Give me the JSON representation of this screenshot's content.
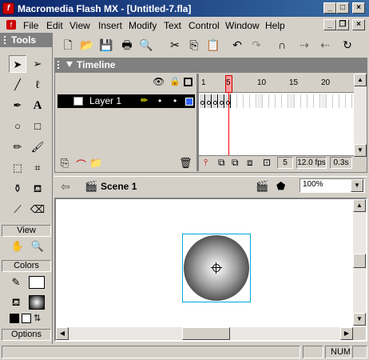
{
  "window": {
    "title": "Macromedia Flash MX - [Untitled-7.fla]",
    "app_icon": "flash-icon",
    "controls": [
      "minimize",
      "maximize",
      "close"
    ]
  },
  "menubar": {
    "items": [
      "File",
      "Edit",
      "View",
      "Insert",
      "Modify",
      "Text",
      "Control",
      "Window",
      "Help"
    ]
  },
  "tools": {
    "title": "Tools",
    "view_label": "View",
    "colors_label": "Colors",
    "options_label": "Options"
  },
  "timeline": {
    "title": "Timeline",
    "layer_name": "Layer 1",
    "frame_numbers": [
      "1",
      "5",
      "10",
      "15",
      "20"
    ],
    "current_frame": "5",
    "fps": "12.0 fps",
    "elapsed": "0.3s"
  },
  "editbar": {
    "scene": "Scene 1",
    "zoom": "100%"
  },
  "status": {
    "num": "NUM"
  },
  "colors": {
    "titlebar_start": "#0a246a",
    "titlebar_end": "#3a6ea5",
    "playhead": "#ff0000",
    "selection_box": "#00aadd",
    "layer_color": "#3366ff"
  }
}
